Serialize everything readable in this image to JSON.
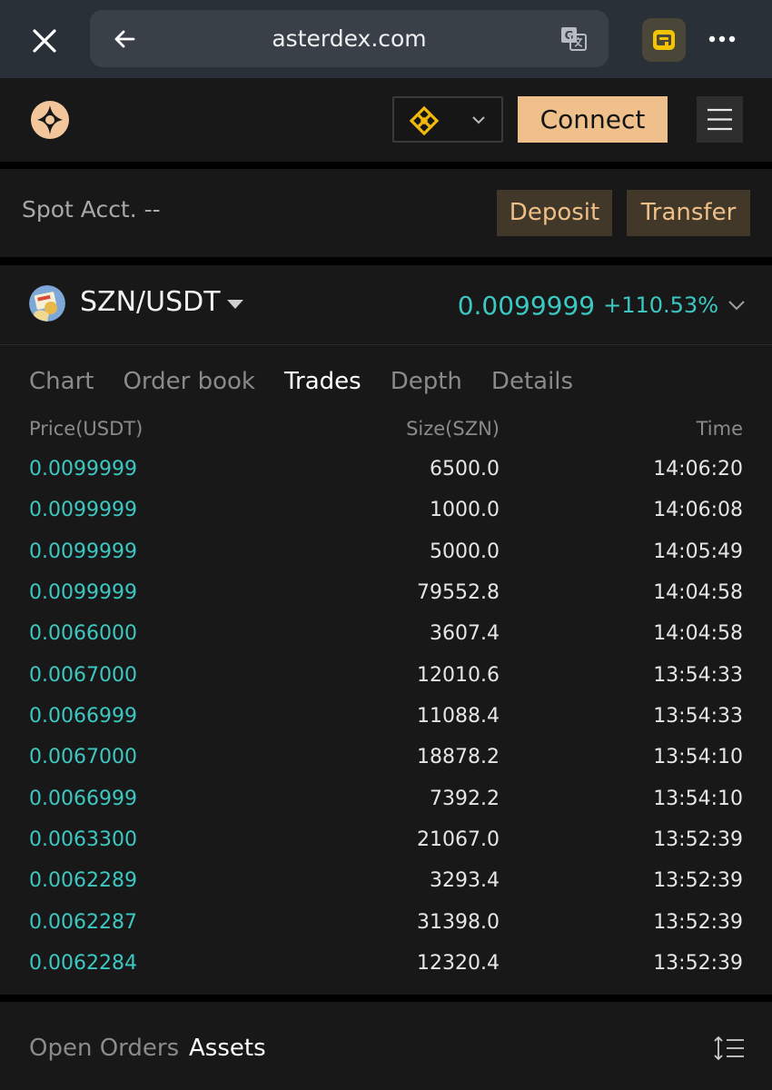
{
  "browser": {
    "url": "asterdex.com"
  },
  "header": {
    "connect_label": "Connect"
  },
  "spot": {
    "label": "Spot Acct. --",
    "deposit_label": "Deposit",
    "transfer_label": "Transfer"
  },
  "market": {
    "pair": "SZN/USDT",
    "last_price": "0.0099999",
    "change": "+110.53%",
    "accent_color": "#3cc8c2"
  },
  "tabs": [
    "Chart",
    "Order book",
    "Trades",
    "Depth",
    "Details"
  ],
  "active_tab": "Trades",
  "trades": {
    "headers": {
      "price": "Price(USDT)",
      "size": "Size(SZN)",
      "time": "Time"
    },
    "rows": [
      {
        "price": "0.0099999",
        "size": "6500.0",
        "time": "14:06:20"
      },
      {
        "price": "0.0099999",
        "size": "1000.0",
        "time": "14:06:08"
      },
      {
        "price": "0.0099999",
        "size": "5000.0",
        "time": "14:05:49"
      },
      {
        "price": "0.0099999",
        "size": "79552.8",
        "time": "14:04:58"
      },
      {
        "price": "0.0066000",
        "size": "3607.4",
        "time": "14:04:58"
      },
      {
        "price": "0.0067000",
        "size": "12010.6",
        "time": "13:54:33"
      },
      {
        "price": "0.0066999",
        "size": "11088.4",
        "time": "13:54:33"
      },
      {
        "price": "0.0067000",
        "size": "18878.2",
        "time": "13:54:10"
      },
      {
        "price": "0.0066999",
        "size": "7392.2",
        "time": "13:54:10"
      },
      {
        "price": "0.0063300",
        "size": "21067.0",
        "time": "13:52:39"
      },
      {
        "price": "0.0062289",
        "size": "3293.4",
        "time": "13:52:39"
      },
      {
        "price": "0.0062287",
        "size": "31398.0",
        "time": "13:52:39"
      },
      {
        "price": "0.0062284",
        "size": "12320.4",
        "time": "13:52:39"
      }
    ]
  },
  "bottom": {
    "open_orders_label": "Open Orders",
    "assets_label": "Assets"
  },
  "colors": {
    "brand": "#f0c08c",
    "panel": "#181818"
  }
}
